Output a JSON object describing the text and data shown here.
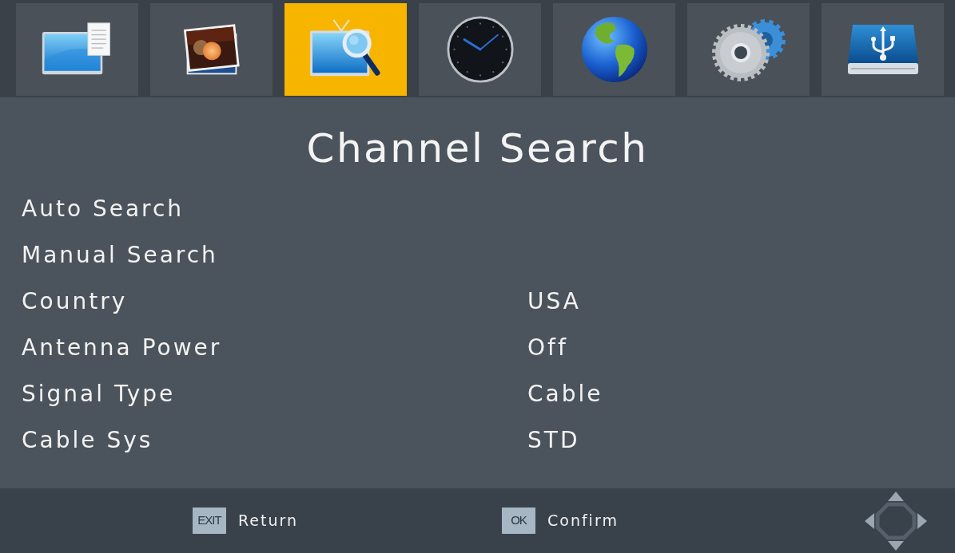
{
  "menu_tabs": [
    {
      "selected": false
    },
    {
      "selected": false
    },
    {
      "selected": true
    },
    {
      "selected": false
    },
    {
      "selected": false
    },
    {
      "selected": false
    },
    {
      "selected": false
    }
  ],
  "title": "Channel Search",
  "settings": [
    {
      "label": "Auto Search"
    },
    {
      "label": "Manual Search"
    },
    {
      "label": "Country",
      "value": "USA"
    },
    {
      "label": "Antenna Power",
      "value": "Off"
    },
    {
      "label": "Signal Type",
      "value": "Cable"
    },
    {
      "label": "Cable Sys",
      "value": "STD"
    }
  ],
  "footer_hints": [
    {
      "key": "EXIT",
      "label": "Return"
    },
    {
      "key": "OK",
      "label": "Confirm"
    }
  ]
}
